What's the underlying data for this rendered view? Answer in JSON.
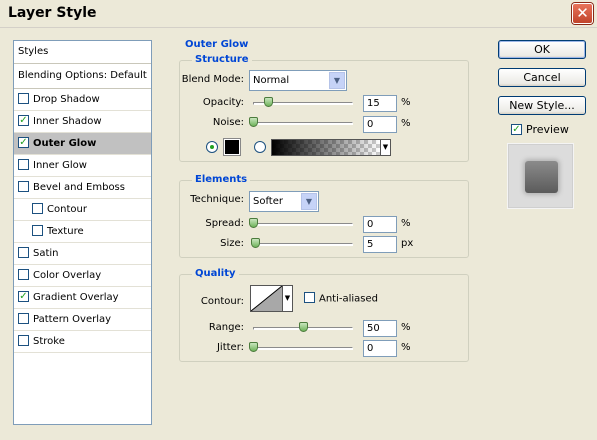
{
  "window": {
    "title": "Layer Style",
    "close_glyph": "✕"
  },
  "styles_list": {
    "header": "Styles",
    "items": [
      {
        "label": "Blending Options: Default",
        "has_checkbox": false,
        "checked": false,
        "selected": false,
        "indent": false
      },
      {
        "label": "Drop Shadow",
        "has_checkbox": true,
        "checked": false,
        "selected": false,
        "indent": false
      },
      {
        "label": "Inner Shadow",
        "has_checkbox": true,
        "checked": true,
        "selected": false,
        "indent": false
      },
      {
        "label": "Outer Glow",
        "has_checkbox": true,
        "checked": true,
        "selected": true,
        "indent": false
      },
      {
        "label": "Inner Glow",
        "has_checkbox": true,
        "checked": false,
        "selected": false,
        "indent": false
      },
      {
        "label": "Bevel and Emboss",
        "has_checkbox": true,
        "checked": false,
        "selected": false,
        "indent": false
      },
      {
        "label": "Contour",
        "has_checkbox": true,
        "checked": false,
        "selected": false,
        "indent": true
      },
      {
        "label": "Texture",
        "has_checkbox": true,
        "checked": false,
        "selected": false,
        "indent": true
      },
      {
        "label": "Satin",
        "has_checkbox": true,
        "checked": false,
        "selected": false,
        "indent": false
      },
      {
        "label": "Color Overlay",
        "has_checkbox": true,
        "checked": false,
        "selected": false,
        "indent": false
      },
      {
        "label": "Gradient Overlay",
        "has_checkbox": true,
        "checked": true,
        "selected": false,
        "indent": false
      },
      {
        "label": "Pattern Overlay",
        "has_checkbox": true,
        "checked": false,
        "selected": false,
        "indent": false
      },
      {
        "label": "Stroke",
        "has_checkbox": true,
        "checked": false,
        "selected": false,
        "indent": false
      }
    ]
  },
  "outer_glow": {
    "title": "Outer Glow",
    "structure": {
      "title": "Structure",
      "blend_mode_label": "Blend Mode:",
      "blend_mode_value": "Normal",
      "opacity_label": "Opacity:",
      "opacity_value": "15",
      "opacity_unit": "%",
      "opacity_level": 0.15,
      "noise_label": "Noise:",
      "noise_value": "0",
      "noise_unit": "%",
      "noise_level": 0,
      "color_mode": "solid"
    },
    "elements": {
      "title": "Elements",
      "technique_label": "Technique:",
      "technique_value": "Softer",
      "spread_label": "Spread:",
      "spread_value": "0",
      "spread_unit": "%",
      "spread_level": 0,
      "size_label": "Size:",
      "size_value": "5",
      "size_unit": "px",
      "size_level": 0.02
    },
    "quality": {
      "title": "Quality",
      "contour_label": "Contour:",
      "anti_aliased_label": "Anti-aliased",
      "anti_aliased_checked": false,
      "range_label": "Range:",
      "range_value": "50",
      "range_unit": "%",
      "range_level": 0.5,
      "jitter_label": "Jitter:",
      "jitter_value": "0",
      "jitter_unit": "%",
      "jitter_level": 0
    }
  },
  "buttons": {
    "ok": "OK",
    "cancel": "Cancel",
    "new_style": "New Style..."
  },
  "preview": {
    "label": "Preview",
    "checked": true
  },
  "colors": {
    "accent": "#0046d5",
    "selected_row": "#c1c1c1",
    "check_green": "#21a121",
    "glow_color": "#000000"
  }
}
